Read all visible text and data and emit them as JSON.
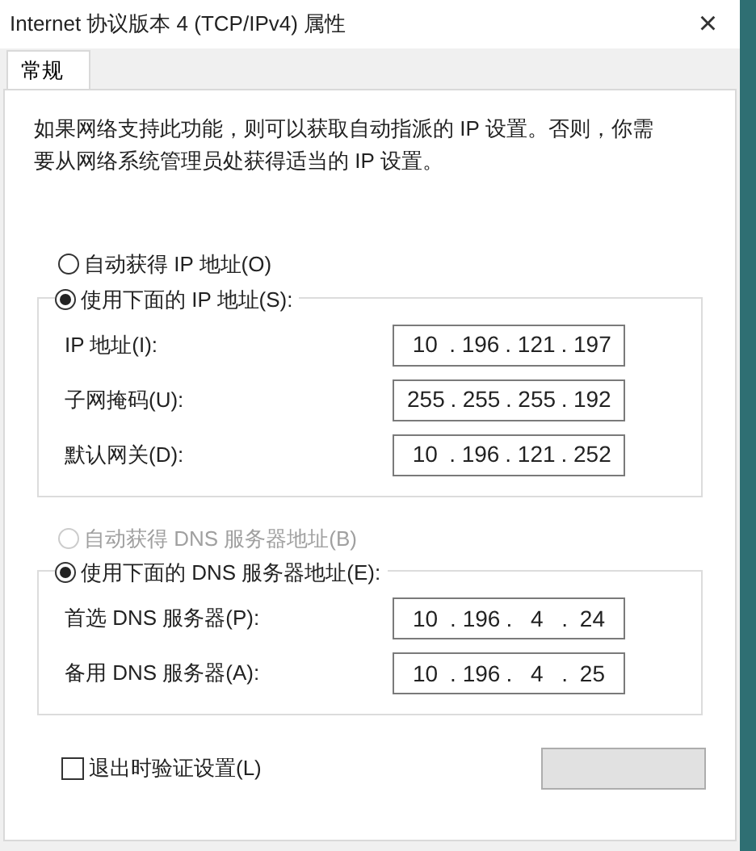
{
  "window": {
    "title": "Internet 协议版本 4 (TCP/IPv4) 属性",
    "close": "×"
  },
  "tabs": [
    {
      "label": "常规",
      "selected": true
    }
  ],
  "description": "如果网络支持此功能，则可以获取自动指派的 IP 设置。否则，你需要从网络系统管理员处获得适当的 IP 设置。",
  "separator": ".",
  "ip_options": [
    {
      "label": "自动获得 IP 地址(O)",
      "selected": false,
      "disabled": false
    },
    {
      "label": "使用下面的 IP 地址(S):",
      "selected": true,
      "disabled": false
    }
  ],
  "ip_fields": [
    {
      "label": "IP 地址(I):",
      "octets": [
        "10",
        "196",
        "121",
        "197"
      ]
    },
    {
      "label": "子网掩码(U):",
      "octets": [
        "255",
        "255",
        "255",
        "192"
      ]
    },
    {
      "label": "默认网关(D):",
      "octets": [
        "10",
        "196",
        "121",
        "252"
      ]
    }
  ],
  "dns_options": [
    {
      "label": "自动获得 DNS 服务器地址(B)",
      "selected": false,
      "disabled": true
    },
    {
      "label": "使用下面的 DNS 服务器地址(E):",
      "selected": true,
      "disabled": false
    }
  ],
  "dns_fields": [
    {
      "label": "首选 DNS 服务器(P):",
      "octets": [
        "10",
        "196",
        "4",
        "24"
      ]
    },
    {
      "label": "备用 DNS 服务器(A):",
      "octets": [
        "10",
        "196",
        "4",
        "25"
      ]
    }
  ],
  "validate": {
    "label": "退出时验证设置(L)",
    "checked": false
  }
}
